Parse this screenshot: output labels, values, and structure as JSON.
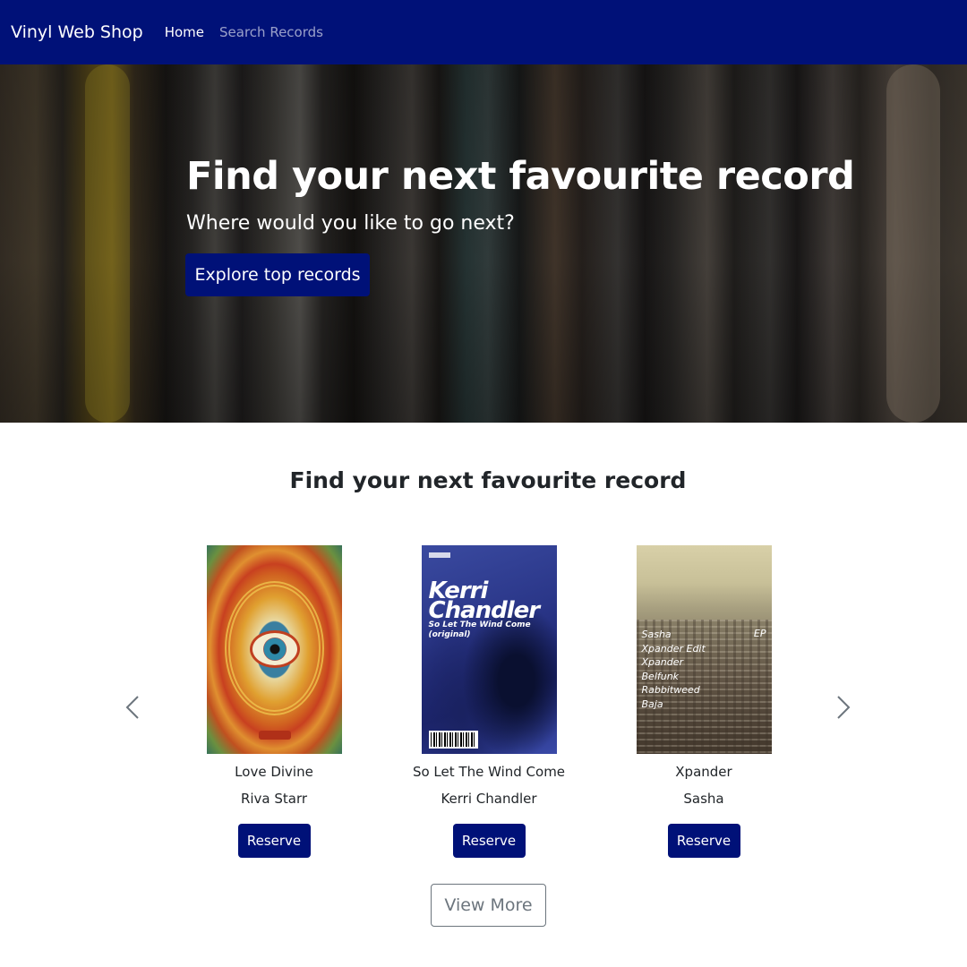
{
  "navbar": {
    "brand": "Vinyl Web Shop",
    "links": [
      {
        "label": "Home",
        "active": true
      },
      {
        "label": "Search Records",
        "active": false
      }
    ]
  },
  "hero": {
    "title": "Find your next favourite record",
    "subtitle": "Where would you like to go next?",
    "button_label": "Explore top records"
  },
  "section": {
    "title": "Find your next favourite record"
  },
  "records": [
    {
      "title": "Love Divine",
      "artist": "Riva Starr",
      "button_label": "Reserve"
    },
    {
      "title": "So Let The Wind Come",
      "artist": "Kerri Chandler",
      "button_label": "Reserve",
      "cover_text": {
        "heading_line1": "Kerri",
        "heading_line2": "Chandler",
        "sub_line1": "So Let The Wind Come",
        "sub_line2": "(original)"
      }
    },
    {
      "title": "Xpander",
      "artist": "Sasha",
      "button_label": "Reserve",
      "cover_text": {
        "tracks": [
          "Sasha",
          "Xpander Edit",
          "Xpander",
          "Belfunk",
          "Rabbitweed",
          "Baja"
        ],
        "tag": "EP"
      }
    }
  ],
  "carousel": {
    "prev_icon": "chevron-left-icon",
    "next_icon": "chevron-right-icon"
  },
  "view_more_label": "View More",
  "colors": {
    "primary": "#001178",
    "muted_border": "#6c757d",
    "text": "#212529"
  }
}
